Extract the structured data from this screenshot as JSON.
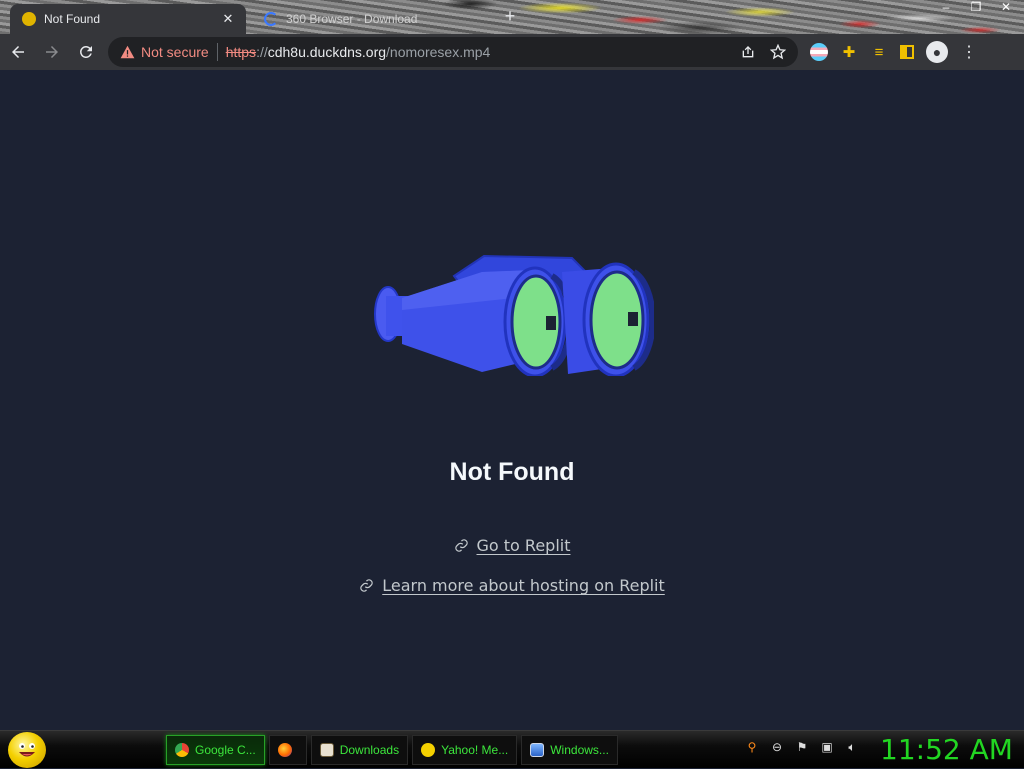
{
  "browser": {
    "tabs": [
      {
        "title": "Not Found",
        "active": true
      },
      {
        "title": "360 Browser - Download",
        "active": false
      }
    ],
    "new_tab_glyph": "+",
    "window_controls": [
      "–",
      "❐",
      "✕"
    ],
    "address": {
      "security_label": "Not secure",
      "protocol": "https",
      "separator": "://",
      "host": "cdh8u.duckdns.org",
      "path": "/nomoresex.mp4"
    }
  },
  "page": {
    "heading": "Not Found",
    "links": [
      {
        "label": "Go to Replit"
      },
      {
        "label": "Learn more about hosting on Replit"
      }
    ],
    "colors": {
      "background": "#1c2233",
      "binocular_body": "#3b4ee8",
      "lens": "#7ee08a"
    }
  },
  "taskbar": {
    "tasks": [
      {
        "label": "Google C...",
        "icon": "chrome-icon",
        "active": true
      },
      {
        "label": "",
        "icon": "firefox-icon",
        "active": false
      },
      {
        "label": "Downloads",
        "icon": "folder-icon",
        "active": false
      },
      {
        "label": "Yahoo! Me...",
        "icon": "yahoo-messenger-icon",
        "active": false
      },
      {
        "label": "Windows...",
        "icon": "windows-explorer-icon",
        "active": false
      }
    ],
    "clock": "11:52 AM",
    "accent_color": "#3ce63c"
  }
}
